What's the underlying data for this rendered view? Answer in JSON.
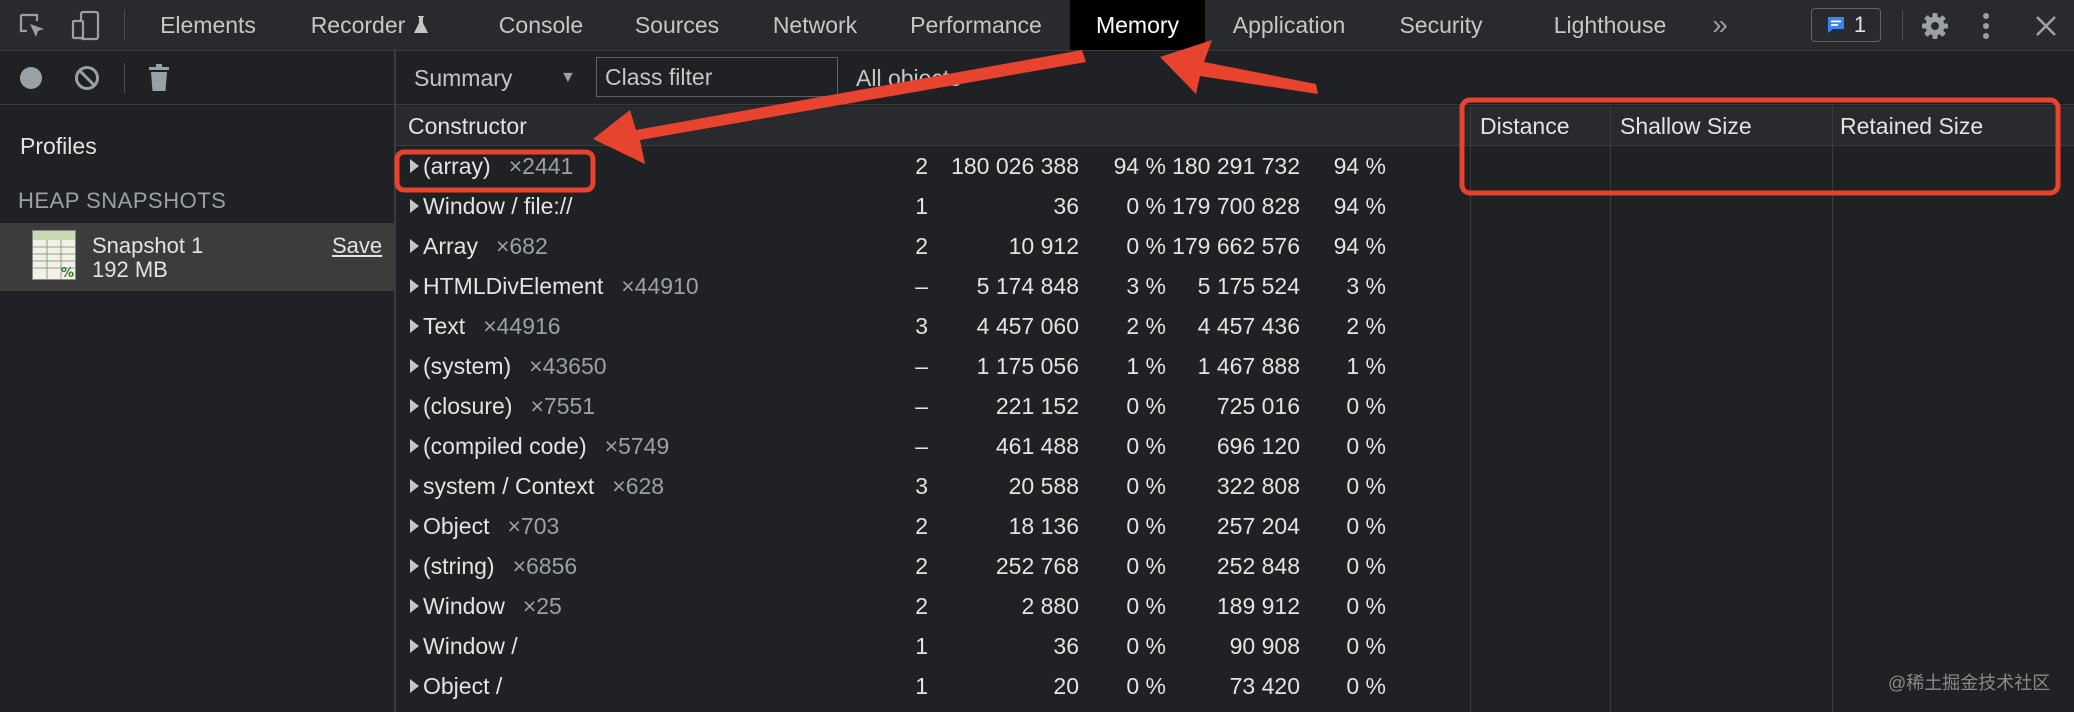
{
  "tabs": [
    {
      "label": "Elements",
      "active": false
    },
    {
      "label": "Recorder",
      "active": false
    },
    {
      "label": "Console",
      "active": false
    },
    {
      "label": "Sources",
      "active": false
    },
    {
      "label": "Network",
      "active": false
    },
    {
      "label": "Performance",
      "active": false
    },
    {
      "label": "Memory",
      "active": true
    },
    {
      "label": "Application",
      "active": false
    },
    {
      "label": "Security",
      "active": false
    },
    {
      "label": "Lighthouse",
      "active": false
    }
  ],
  "toolbar": {
    "overflow_glyph": "»",
    "issues_count": "1",
    "icons": [
      "inspect-icon",
      "device-toggle-icon",
      "recorder-flask-icon",
      "issues-icon",
      "gear-icon",
      "more-icon",
      "close-icon"
    ]
  },
  "sidebar": {
    "profiles_label": "Profiles",
    "section_label": "HEAP SNAPSHOTS",
    "snapshot": {
      "name": "Snapshot 1",
      "size": "192 MB",
      "save_label": "Save"
    }
  },
  "main_toolbar": {
    "view": "Summary",
    "class_filter_placeholder": "Class filter",
    "object_filter": "All objects"
  },
  "table": {
    "headers": {
      "constructor": "Constructor",
      "distance": "Distance",
      "shallow": "Shallow Size",
      "retained": "Retained Size"
    },
    "rows": [
      {
        "name": "(array)",
        "count": "×2441",
        "distance": "2",
        "shallow": "180 026 388",
        "shallow_pct": "94 %",
        "retained": "180 291 732",
        "retained_pct": "94 %"
      },
      {
        "name": "Window / file://",
        "count": "",
        "distance": "1",
        "shallow": "36",
        "shallow_pct": "0 %",
        "retained": "179 700 828",
        "retained_pct": "94 %"
      },
      {
        "name": "Array",
        "count": "×682",
        "distance": "2",
        "shallow": "10 912",
        "shallow_pct": "0 %",
        "retained": "179 662 576",
        "retained_pct": "94 %"
      },
      {
        "name": "HTMLDivElement",
        "count": "×44910",
        "distance": "–",
        "shallow": "5 174 848",
        "shallow_pct": "3 %",
        "retained": "5 175 524",
        "retained_pct": "3 %"
      },
      {
        "name": "Text",
        "count": "×44916",
        "distance": "3",
        "shallow": "4 457 060",
        "shallow_pct": "2 %",
        "retained": "4 457 436",
        "retained_pct": "2 %"
      },
      {
        "name": "(system)",
        "count": "×43650",
        "distance": "–",
        "shallow": "1 175 056",
        "shallow_pct": "1 %",
        "retained": "1 467 888",
        "retained_pct": "1 %"
      },
      {
        "name": "(closure)",
        "count": "×7551",
        "distance": "–",
        "shallow": "221 152",
        "shallow_pct": "0 %",
        "retained": "725 016",
        "retained_pct": "0 %"
      },
      {
        "name": "(compiled code)",
        "count": "×5749",
        "distance": "–",
        "shallow": "461 488",
        "shallow_pct": "0 %",
        "retained": "696 120",
        "retained_pct": "0 %"
      },
      {
        "name": "system / Context",
        "count": "×628",
        "distance": "3",
        "shallow": "20 588",
        "shallow_pct": "0 %",
        "retained": "322 808",
        "retained_pct": "0 %"
      },
      {
        "name": "Object",
        "count": "×703",
        "distance": "2",
        "shallow": "18 136",
        "shallow_pct": "0 %",
        "retained": "257 204",
        "retained_pct": "0 %"
      },
      {
        "name": "(string)",
        "count": "×6856",
        "distance": "2",
        "shallow": "252 768",
        "shallow_pct": "0 %",
        "retained": "252 848",
        "retained_pct": "0 %"
      },
      {
        "name": "Window",
        "count": "×25",
        "distance": "2",
        "shallow": "2 880",
        "shallow_pct": "0 %",
        "retained": "189 912",
        "retained_pct": "0 %"
      },
      {
        "name": "Window /",
        "count": "",
        "distance": "1",
        "shallow": "36",
        "shallow_pct": "0 %",
        "retained": "90 908",
        "retained_pct": "0 %"
      },
      {
        "name": "Object /",
        "count": "",
        "distance": "1",
        "shallow": "20",
        "shallow_pct": "0 %",
        "retained": "73 420",
        "retained_pct": "0 %"
      }
    ]
  },
  "annotations": {
    "color": "#e8432e"
  },
  "watermark": "@稀土掘金技术社区"
}
